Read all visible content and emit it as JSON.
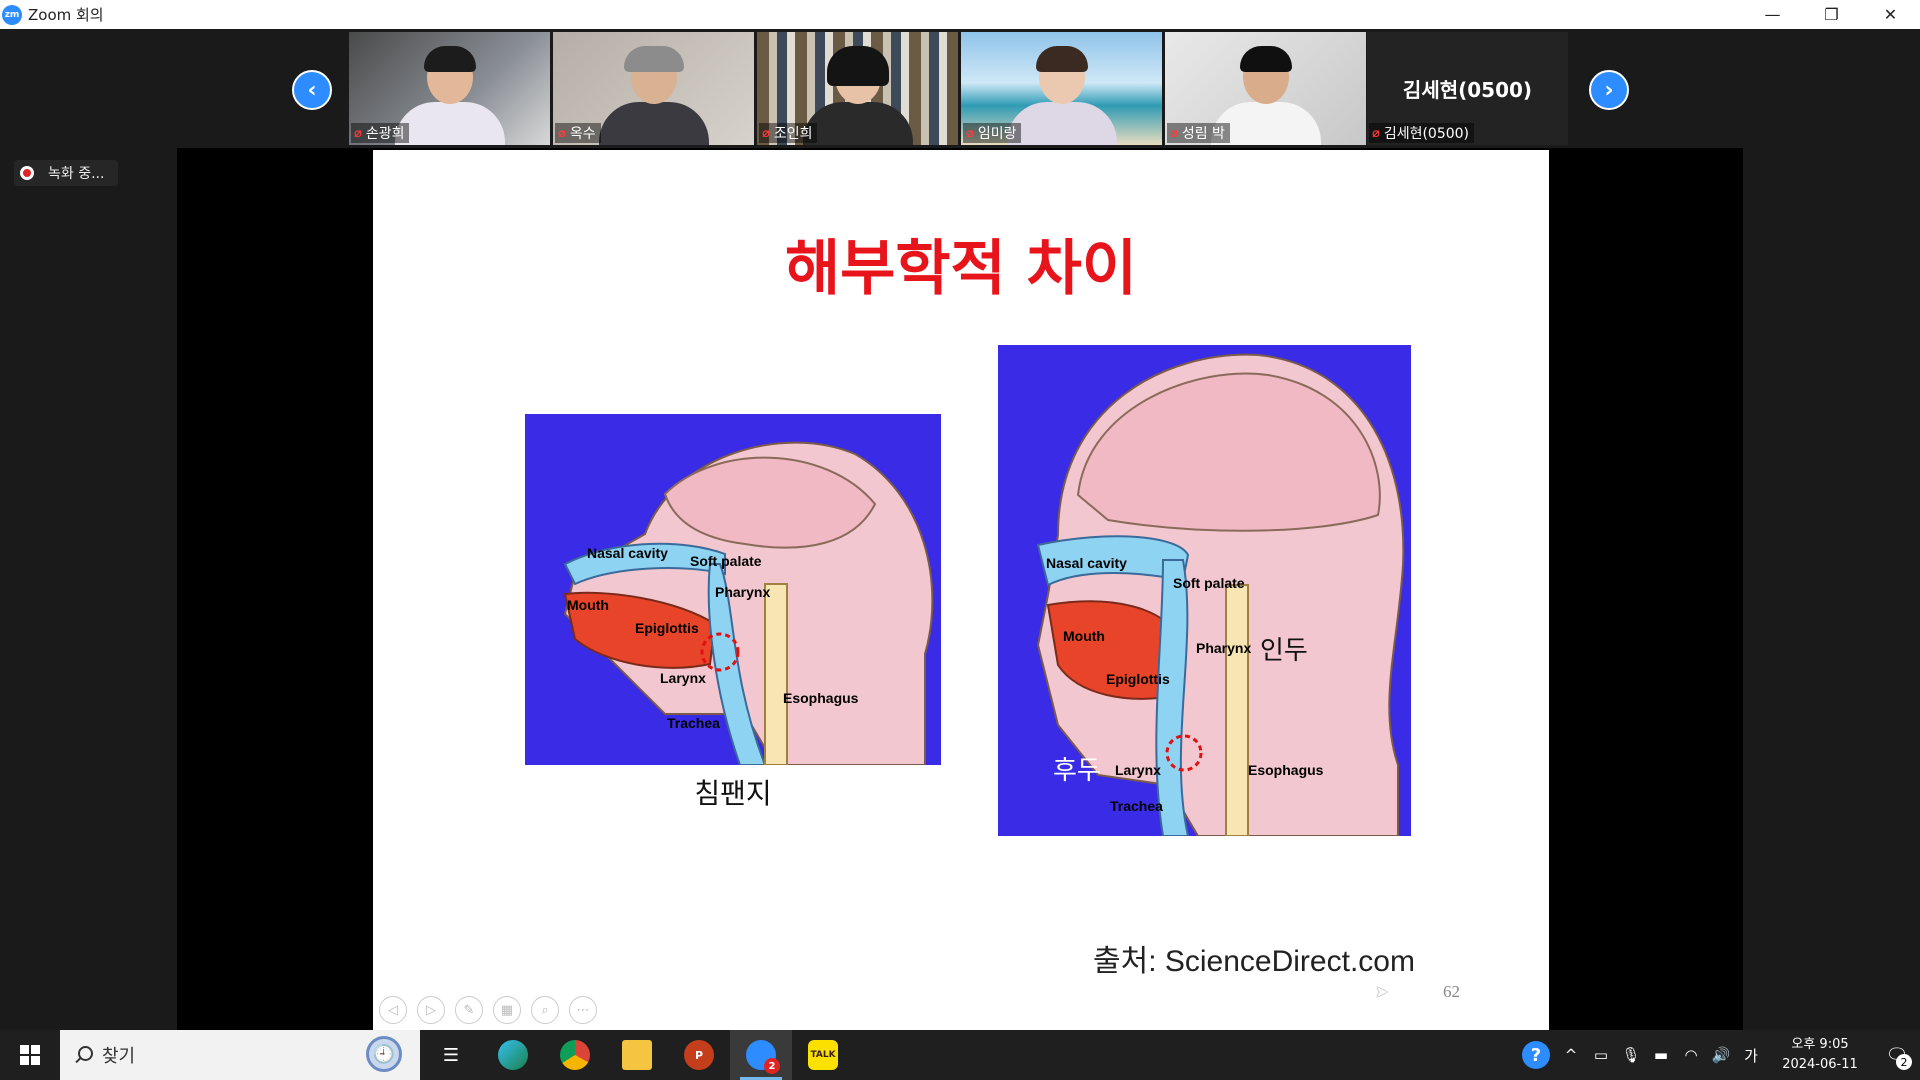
{
  "window": {
    "title": "Zoom 회의",
    "logo_text": "zm",
    "minimize_glyph": "—",
    "restore_glyph": "❐",
    "close_glyph": "✕"
  },
  "participants": {
    "nav_prev_glyph": "‹",
    "nav_next_glyph": "›",
    "tiles": [
      {
        "name": "손광희"
      },
      {
        "name": "옥수"
      },
      {
        "name": "조인희"
      },
      {
        "name": "임미랑"
      },
      {
        "name": "성림 박"
      },
      {
        "name": "김세현(0500)",
        "display_name": "김세현(0500)"
      }
    ],
    "muted_icon": "mic-muted-icon"
  },
  "recording": {
    "label": "녹화 중..."
  },
  "slide": {
    "title": "해부학적 차이",
    "chimp": {
      "caption": "침팬지",
      "labels": {
        "nasal": "Nasal cavity",
        "soft_palate": "Soft palate",
        "pharynx": "Pharynx",
        "mouth": "Mouth",
        "epiglottis": "Epiglottis",
        "larynx": "Larynx",
        "esophagus": "Esophagus",
        "trachea": "Trachea"
      }
    },
    "human": {
      "labels": {
        "nasal": "Nasal cavity",
        "soft_palate": "Soft palate",
        "mouth": "Mouth",
        "pharynx": "Pharynx",
        "epiglottis": "Epiglottis",
        "larynx": "Larynx",
        "esophagus": "Esophagus",
        "trachea": "Trachea"
      },
      "ko_pharynx": "인두",
      "ko_larynx": "후두"
    },
    "source": "출처: ScienceDirect.com",
    "page_number": "62"
  },
  "taskbar": {
    "search_placeholder": "찾기",
    "clock_time": "오후 9:05",
    "clock_date": "2024-06-11",
    "ime": "가",
    "notification_count": "2",
    "zoom_badge": "2",
    "kakao_label": "TALK"
  },
  "colors": {
    "zoom_blue": "#2d8cff",
    "slide_title_red": "#e8141b",
    "panel_bg": "#3a2be6"
  }
}
